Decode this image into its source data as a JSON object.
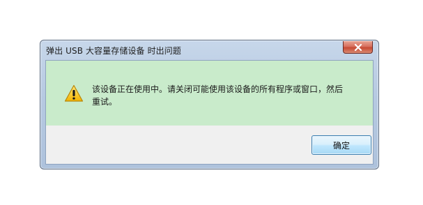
{
  "dialog": {
    "title": "弹出 USB 大容量存储设备 时出问题",
    "message": "该设备正在使用中。请关闭可能使用该设备的所有程序或窗口，然后重试。",
    "ok_label": "确定",
    "icon": "warning-icon",
    "close_icon": "close-icon",
    "colors": {
      "content_bg": "#c9ebcb",
      "footer_bg": "#f0f0f0",
      "close_red": "#c74a33"
    }
  }
}
